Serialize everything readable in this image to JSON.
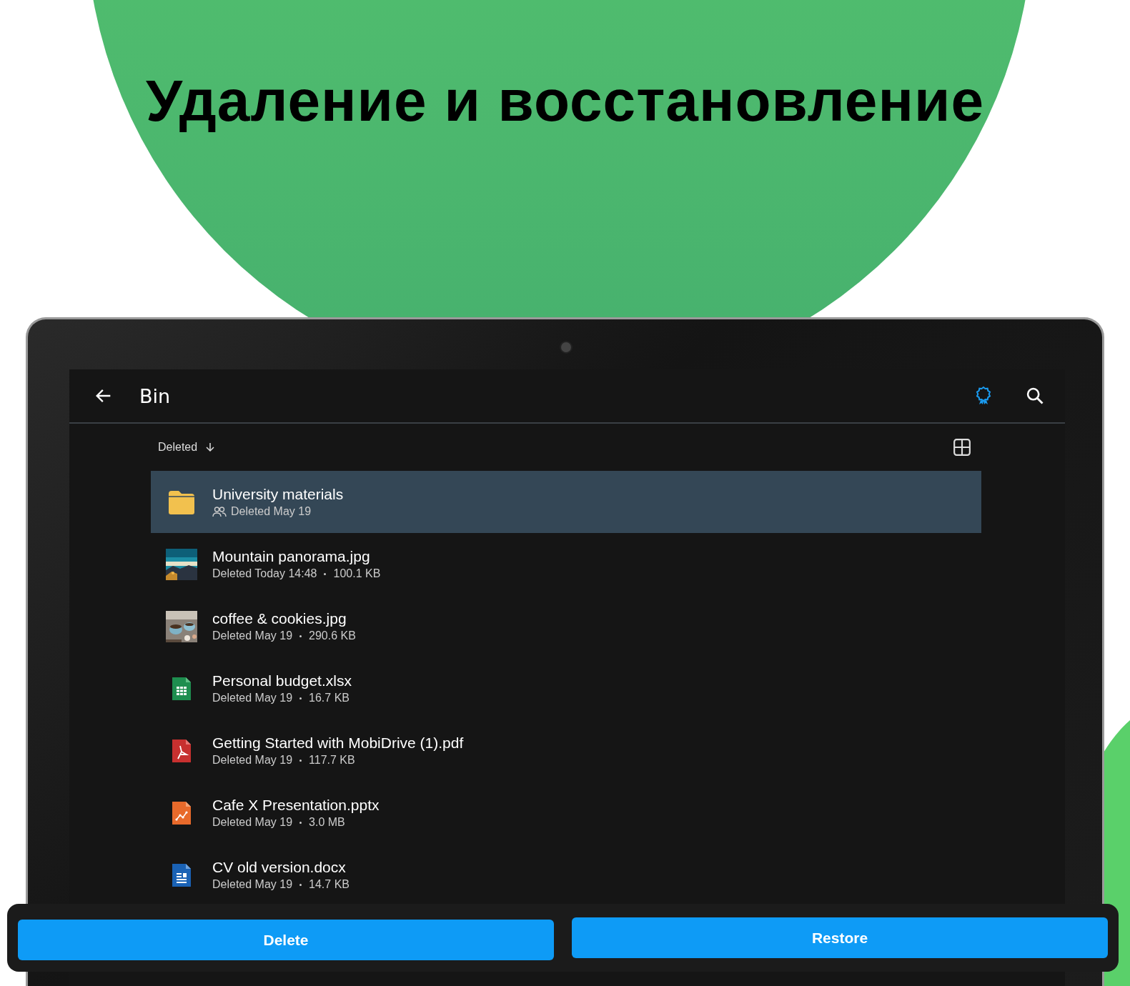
{
  "headline": "Удаление и восстановление",
  "toolbar": {
    "title": "Bin"
  },
  "sort": {
    "label": "Deleted"
  },
  "files": [
    {
      "kind": "folder",
      "name": "University materials",
      "shared": true,
      "date": "Deleted May 19",
      "selected": true
    },
    {
      "name": "Mountain panorama.jpg",
      "shared": false,
      "date": "Deleted Today 14:48",
      "size": "100.1 KB",
      "selected": false
    },
    {
      "name": "coffee & cookies.jpg",
      "shared": false,
      "date": "Deleted May 19",
      "size": "290.6 KB",
      "selected": false
    },
    {
      "kind": "sheet",
      "name": "Personal budget.xlsx",
      "shared": false,
      "date": "Deleted May 19",
      "size": "16.7 KB",
      "selected": false
    },
    {
      "kind": "pdf",
      "name": "Getting Started with MobiDrive (1).pdf",
      "shared": false,
      "date": "Deleted May 19",
      "size": "117.7 KB",
      "selected": false
    },
    {
      "kind": "slides",
      "name": "Cafe X Presentation.pptx",
      "shared": false,
      "date": "Deleted May 19",
      "size": "3.0 MB",
      "selected": false
    },
    {
      "kind": "doc",
      "name": "CV old version.docx",
      "shared": false,
      "date": "Deleted May 19",
      "size": "14.7 KB",
      "selected": false
    }
  ],
  "actions": [
    "Delete",
    "Restore"
  ]
}
